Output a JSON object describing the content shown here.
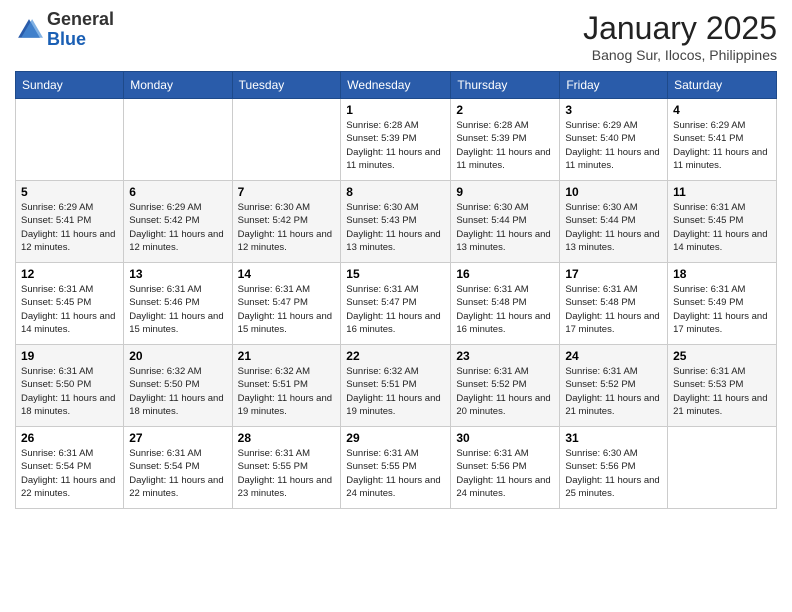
{
  "header": {
    "logo_general": "General",
    "logo_blue": "Blue",
    "month": "January 2025",
    "location": "Banog Sur, Ilocos, Philippines"
  },
  "days_of_week": [
    "Sunday",
    "Monday",
    "Tuesday",
    "Wednesday",
    "Thursday",
    "Friday",
    "Saturday"
  ],
  "weeks": [
    [
      {
        "day": "",
        "info": ""
      },
      {
        "day": "",
        "info": ""
      },
      {
        "day": "",
        "info": ""
      },
      {
        "day": "1",
        "info": "Sunrise: 6:28 AM\nSunset: 5:39 PM\nDaylight: 11 hours and 11 minutes."
      },
      {
        "day": "2",
        "info": "Sunrise: 6:28 AM\nSunset: 5:39 PM\nDaylight: 11 hours and 11 minutes."
      },
      {
        "day": "3",
        "info": "Sunrise: 6:29 AM\nSunset: 5:40 PM\nDaylight: 11 hours and 11 minutes."
      },
      {
        "day": "4",
        "info": "Sunrise: 6:29 AM\nSunset: 5:41 PM\nDaylight: 11 hours and 11 minutes."
      }
    ],
    [
      {
        "day": "5",
        "info": "Sunrise: 6:29 AM\nSunset: 5:41 PM\nDaylight: 11 hours and 12 minutes."
      },
      {
        "day": "6",
        "info": "Sunrise: 6:29 AM\nSunset: 5:42 PM\nDaylight: 11 hours and 12 minutes."
      },
      {
        "day": "7",
        "info": "Sunrise: 6:30 AM\nSunset: 5:42 PM\nDaylight: 11 hours and 12 minutes."
      },
      {
        "day": "8",
        "info": "Sunrise: 6:30 AM\nSunset: 5:43 PM\nDaylight: 11 hours and 13 minutes."
      },
      {
        "day": "9",
        "info": "Sunrise: 6:30 AM\nSunset: 5:44 PM\nDaylight: 11 hours and 13 minutes."
      },
      {
        "day": "10",
        "info": "Sunrise: 6:30 AM\nSunset: 5:44 PM\nDaylight: 11 hours and 13 minutes."
      },
      {
        "day": "11",
        "info": "Sunrise: 6:31 AM\nSunset: 5:45 PM\nDaylight: 11 hours and 14 minutes."
      }
    ],
    [
      {
        "day": "12",
        "info": "Sunrise: 6:31 AM\nSunset: 5:45 PM\nDaylight: 11 hours and 14 minutes."
      },
      {
        "day": "13",
        "info": "Sunrise: 6:31 AM\nSunset: 5:46 PM\nDaylight: 11 hours and 15 minutes."
      },
      {
        "day": "14",
        "info": "Sunrise: 6:31 AM\nSunset: 5:47 PM\nDaylight: 11 hours and 15 minutes."
      },
      {
        "day": "15",
        "info": "Sunrise: 6:31 AM\nSunset: 5:47 PM\nDaylight: 11 hours and 16 minutes."
      },
      {
        "day": "16",
        "info": "Sunrise: 6:31 AM\nSunset: 5:48 PM\nDaylight: 11 hours and 16 minutes."
      },
      {
        "day": "17",
        "info": "Sunrise: 6:31 AM\nSunset: 5:48 PM\nDaylight: 11 hours and 17 minutes."
      },
      {
        "day": "18",
        "info": "Sunrise: 6:31 AM\nSunset: 5:49 PM\nDaylight: 11 hours and 17 minutes."
      }
    ],
    [
      {
        "day": "19",
        "info": "Sunrise: 6:31 AM\nSunset: 5:50 PM\nDaylight: 11 hours and 18 minutes."
      },
      {
        "day": "20",
        "info": "Sunrise: 6:32 AM\nSunset: 5:50 PM\nDaylight: 11 hours and 18 minutes."
      },
      {
        "day": "21",
        "info": "Sunrise: 6:32 AM\nSunset: 5:51 PM\nDaylight: 11 hours and 19 minutes."
      },
      {
        "day": "22",
        "info": "Sunrise: 6:32 AM\nSunset: 5:51 PM\nDaylight: 11 hours and 19 minutes."
      },
      {
        "day": "23",
        "info": "Sunrise: 6:31 AM\nSunset: 5:52 PM\nDaylight: 11 hours and 20 minutes."
      },
      {
        "day": "24",
        "info": "Sunrise: 6:31 AM\nSunset: 5:52 PM\nDaylight: 11 hours and 21 minutes."
      },
      {
        "day": "25",
        "info": "Sunrise: 6:31 AM\nSunset: 5:53 PM\nDaylight: 11 hours and 21 minutes."
      }
    ],
    [
      {
        "day": "26",
        "info": "Sunrise: 6:31 AM\nSunset: 5:54 PM\nDaylight: 11 hours and 22 minutes."
      },
      {
        "day": "27",
        "info": "Sunrise: 6:31 AM\nSunset: 5:54 PM\nDaylight: 11 hours and 22 minutes."
      },
      {
        "day": "28",
        "info": "Sunrise: 6:31 AM\nSunset: 5:55 PM\nDaylight: 11 hours and 23 minutes."
      },
      {
        "day": "29",
        "info": "Sunrise: 6:31 AM\nSunset: 5:55 PM\nDaylight: 11 hours and 24 minutes."
      },
      {
        "day": "30",
        "info": "Sunrise: 6:31 AM\nSunset: 5:56 PM\nDaylight: 11 hours and 24 minutes."
      },
      {
        "day": "31",
        "info": "Sunrise: 6:30 AM\nSunset: 5:56 PM\nDaylight: 11 hours and 25 minutes."
      },
      {
        "day": "",
        "info": ""
      }
    ]
  ]
}
